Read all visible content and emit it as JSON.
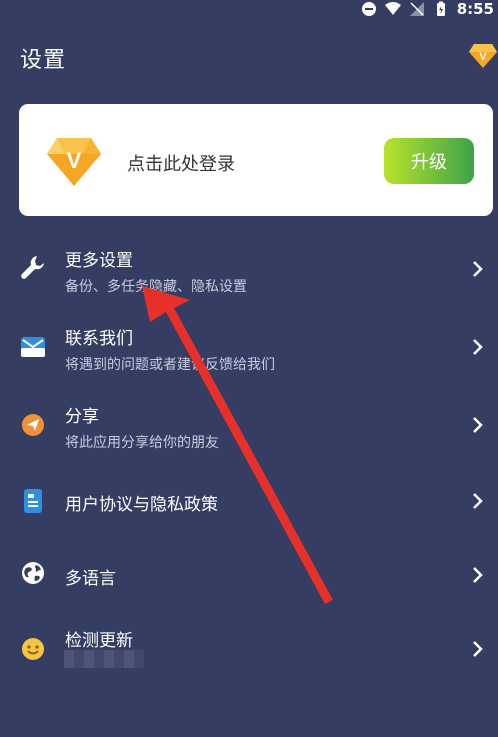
{
  "status_bar": {
    "time": "8:55"
  },
  "header": {
    "title": "设置"
  },
  "login_card": {
    "login_text": "点击此处登录",
    "upgrade_label": "升级",
    "badge_letter": "V"
  },
  "menu": [
    {
      "title": "更多设置",
      "subtitle": "备份、多任务隐藏、隐私设置",
      "icon": "wrench-icon"
    },
    {
      "title": "联系我们",
      "subtitle": "将遇到的问题或者建议反馈给我们",
      "icon": "mail-icon"
    },
    {
      "title": "分享",
      "subtitle": "将此应用分享给你的朋友",
      "icon": "share-icon"
    },
    {
      "title": "用户协议与隐私政策",
      "subtitle": "",
      "icon": "document-icon"
    },
    {
      "title": "多语言",
      "subtitle": "",
      "icon": "globe-icon"
    },
    {
      "title": "检测更新",
      "subtitle": "",
      "icon": "smiley-icon"
    }
  ],
  "colors": {
    "background": "#363d63",
    "accent_orange": "#f5a623",
    "upgrade_start": "#b8e32a",
    "upgrade_end": "#3ea24a",
    "annotation_arrow": "#e8302a"
  }
}
